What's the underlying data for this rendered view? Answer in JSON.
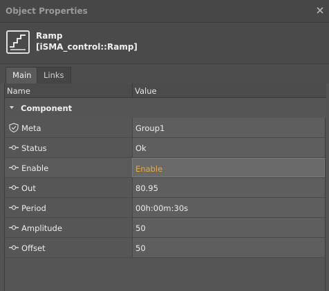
{
  "panel": {
    "title": "Object Properties"
  },
  "object": {
    "name": "Ramp",
    "type": "[iSMA_control::Ramp]",
    "icon": "ramp-icon"
  },
  "tabs": [
    {
      "label": "Main"
    },
    {
      "label": "Links"
    }
  ],
  "columns": {
    "name": "Name",
    "value": "Value"
  },
  "group": {
    "label": "Component"
  },
  "properties": [
    {
      "name": "Meta",
      "value": "Group1",
      "icon": "shield-icon"
    },
    {
      "name": "Status",
      "value": "Ok",
      "icon": "slot-icon"
    },
    {
      "name": "Enable",
      "value": "Enable",
      "icon": "slot-icon",
      "accent": "#f0a830"
    },
    {
      "name": "Out",
      "value": "80.95",
      "icon": "slot-icon"
    },
    {
      "name": "Period",
      "value": "00h:00m:30s",
      "icon": "slot-icon"
    },
    {
      "name": "Amplitude",
      "value": "50",
      "icon": "slot-icon"
    },
    {
      "name": "Offset",
      "value": "50",
      "icon": "slot-icon"
    }
  ]
}
